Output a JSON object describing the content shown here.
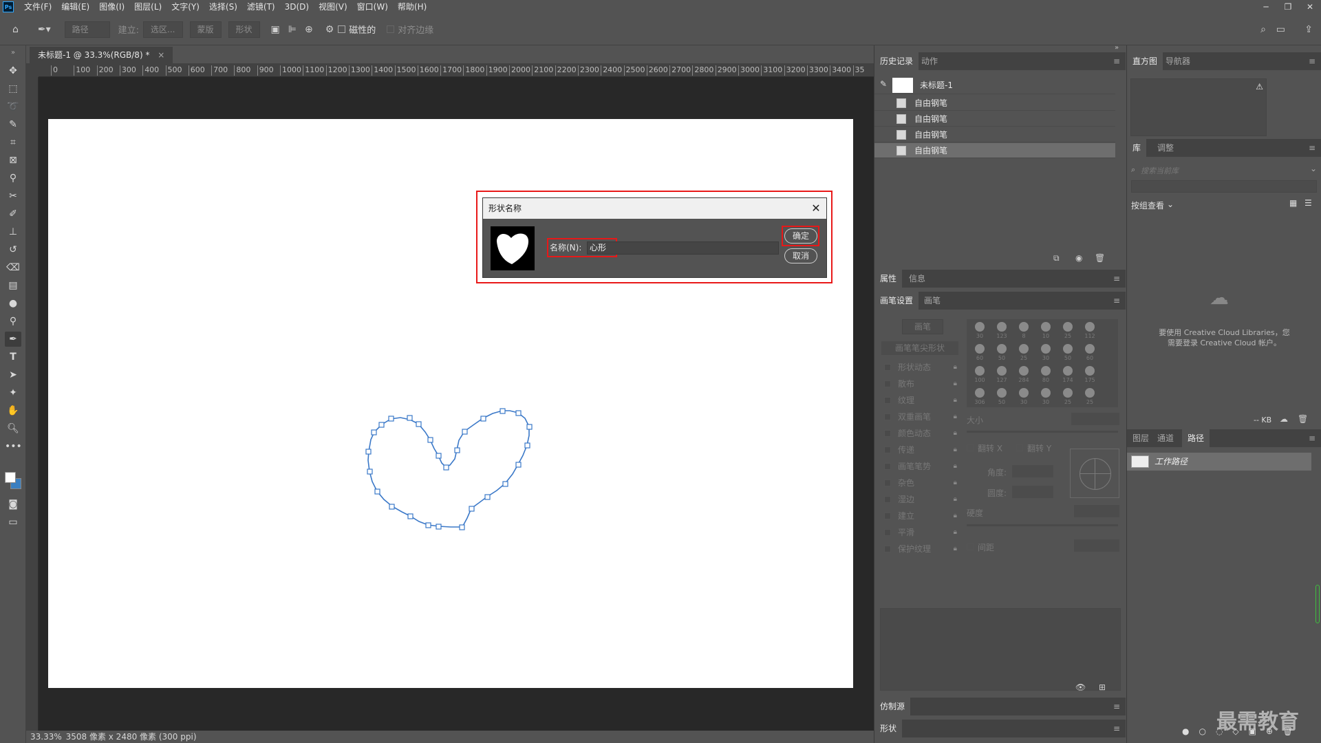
{
  "menubar": {
    "logo": "Ps",
    "items": [
      "文件(F)",
      "编辑(E)",
      "图像(I)",
      "图层(L)",
      "文字(Y)",
      "选择(S)",
      "滤镜(T)",
      "3D(D)",
      "视图(V)",
      "窗口(W)",
      "帮助(H)"
    ]
  },
  "options": {
    "path_mode": "路径",
    "make_label": "建立:",
    "selection_btn": "选区...",
    "mask_btn": "蒙版",
    "shape_btn": "形状",
    "magnetic_label": "磁性的",
    "align_edges_label": "对齐边缘"
  },
  "document": {
    "tab_title": "未标题-1 @ 33.3%(RGB/8) *",
    "tab_close": "×",
    "ruler_top": [
      "0",
      "100",
      "200",
      "300",
      "400",
      "500",
      "600",
      "700",
      "800",
      "900",
      "1000",
      "1100",
      "1200",
      "1300",
      "1400",
      "1500",
      "1600",
      "1700",
      "1800",
      "1900",
      "2000",
      "2100",
      "2200",
      "2300",
      "2400",
      "2500",
      "2600",
      "2700",
      "2800",
      "2900",
      "3000",
      "3100",
      "3200",
      "3300",
      "3400",
      "35"
    ],
    "status_zoom": "33.33%",
    "status_info": "3508 像素 x 2480 像素 (300 ppi)"
  },
  "dialog": {
    "title": "形状名称",
    "name_label": "名称(N):",
    "name_value": "心形",
    "ok_label": "确定",
    "cancel_label": "取消"
  },
  "history_panel": {
    "tabs": [
      "历史记录",
      "动作"
    ],
    "snapshot_label": "未标题-1",
    "items": [
      "自由钢笔",
      "自由钢笔",
      "自由钢笔",
      "自由钢笔"
    ]
  },
  "properties_panel": {
    "tabs": [
      "属性",
      "信息"
    ]
  },
  "brush_panel": {
    "tabs": [
      "画笔设置",
      "画笔"
    ],
    "brushes_btn": "画笔",
    "tip_shape": "画笔笔尖形状",
    "options": [
      "形状动态",
      "散布",
      "纹理",
      "双重画笔",
      "颜色动态",
      "传递",
      "画笔笔势",
      "杂色",
      "湿边",
      "建立",
      "平滑",
      "保护纹理"
    ],
    "brush_sizes": [
      "30",
      "123",
      "8",
      "10",
      "25",
      "112",
      "60",
      "50",
      "25",
      "30",
      "50",
      "60",
      "100",
      "127",
      "284",
      "80",
      "174",
      "175",
      "306",
      "50",
      "30",
      "30",
      "25",
      "25"
    ],
    "size_label": "大小",
    "flip_x": "翻转 X",
    "flip_y": "翻转 Y",
    "angle_label": "角度:",
    "roundness_label": "圆度:",
    "hardness_label": "硬度",
    "spacing_label": "间距"
  },
  "clone_panel": {
    "title": "仿制源"
  },
  "shapes_panel": {
    "title": "形状"
  },
  "histogram_panel": {
    "tabs": [
      "直方图",
      "导航器"
    ],
    "warning_icon": "⚠"
  },
  "library_panel": {
    "tabs": [
      "库",
      "调整"
    ],
    "search_placeholder": "搜索当前库",
    "group_view": "按组查看",
    "message_line1": "要使用 Creative Cloud Libraries，您",
    "message_line2": "需要登录 Creative Cloud 帐户。",
    "kb": "-- KB"
  },
  "layers_panel": {
    "tabs": [
      "图层",
      "通道",
      "路径"
    ],
    "path_name": "工作路径"
  },
  "watermark": "最需教育"
}
